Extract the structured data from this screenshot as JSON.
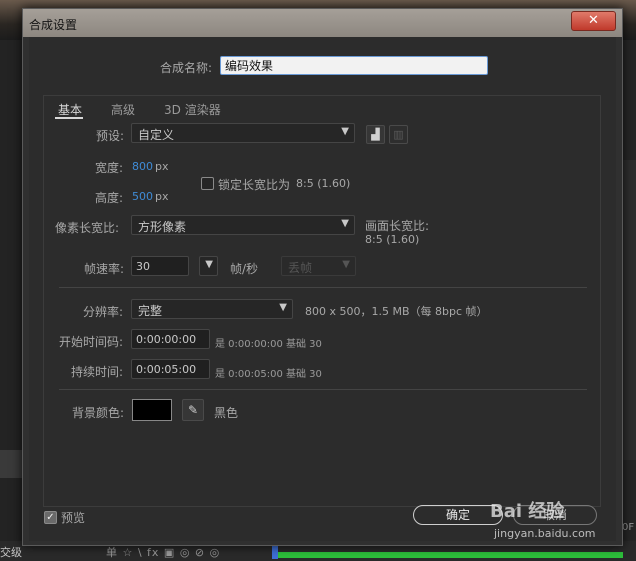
{
  "dialog": {
    "title": "合成设置",
    "close_label": "✕"
  },
  "comp_name": {
    "label": "合成名称:",
    "value": "编码效果"
  },
  "tabs": [
    {
      "label": "基本",
      "active": true
    },
    {
      "label": "高级",
      "active": false
    },
    {
      "label": "3D 渲染器",
      "active": false
    }
  ],
  "basic": {
    "preset_label": "预设:",
    "preset_value": "自定义",
    "width_label": "宽度:",
    "width_value": "800",
    "width_unit": "px",
    "height_label": "高度:",
    "height_value": "500",
    "height_unit": "px",
    "lock_label": "锁定长宽比为",
    "lock_ratio": "8:5 (1.60)",
    "pixel_aspect_label": "像素长宽比:",
    "pixel_aspect_value": "方形像素",
    "frame_aspect_label": "画面长宽比:",
    "frame_aspect_value": "8:5 (1.60)",
    "frame_rate_label": "帧速率:",
    "frame_rate_value": "30",
    "frame_rate_unit": "帧/秒",
    "drop_frame_value": "丢帧",
    "resolution_label": "分辨率:",
    "resolution_value": "完整",
    "resolution_info": "800 x 500，1.5 MB（每 8bpc 帧）",
    "start_tc_label": "开始时间码:",
    "start_tc_value": "0:00:00:00",
    "start_tc_info": "是 0:00:00:00 基础 30",
    "duration_label": "持续时间:",
    "duration_value": "0:00:05:00",
    "duration_info": "是 0:00:05:00 基础 30",
    "bg_color_label": "背景颜色:",
    "bg_color_name": "黑色",
    "bg_color_hex": "#000000"
  },
  "footer": {
    "preview_label": "预览",
    "ok_label": "确定",
    "cancel_label": "取消"
  },
  "background": {
    "bottom_left_text": "交级",
    "tools_text": "单 ☆ \\ fx ▣ ◎ ⊘ ◎",
    "right_edge_text": "0F"
  },
  "watermark": {
    "logo": "Bai 经验",
    "url": "jingyan.baidu.com"
  }
}
